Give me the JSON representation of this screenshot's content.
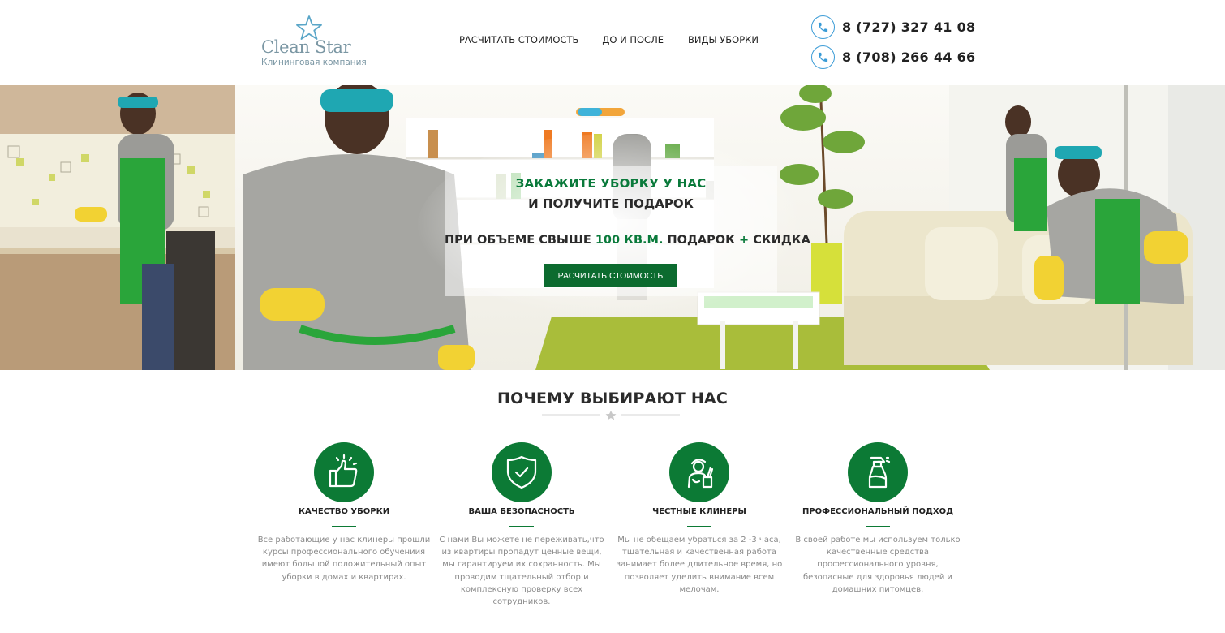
{
  "header": {
    "logo_name": "Clean Star",
    "logo_sub": "Клининговая компания",
    "nav": [
      "Расчитать стоимость",
      "До и после",
      "Виды уборки"
    ],
    "phones": [
      "8 (727) 327 41 08",
      "8 (708) 266 44 66"
    ],
    "colors": {
      "logo": "#7a96a3",
      "phone_icon": "#3a9bd6"
    }
  },
  "hero": {
    "line1": "ЗАКАЖИТЕ УБОРКУ У НАС",
    "line2": "И ПОЛУЧИТЕ ПОДАРОК",
    "line3_a": "ПРИ ОБЪЕМЕ СВЫШЕ ",
    "line3_b": "100 КВ.М.",
    "line3_c": " ПОДАРОК ",
    "line3_d": "+",
    "line3_e": " СКИДКА",
    "button": "РАСЧИТАТЬ СТОИМОСТЬ",
    "colors": {
      "accent": "#0a7a3b",
      "button": "#0c6b2f"
    }
  },
  "why": {
    "title": "ПОЧЕМУ ВЫБИРАЮТ НАС",
    "features": [
      {
        "icon": "thumbs-up-icon",
        "title": "КАЧЕСТВО УБОРКИ",
        "text": "Все работающие у нас клинеры прошли курсы профессионального обучениия имеют большой положительный опыт уборки в домах и квартирах."
      },
      {
        "icon": "shield-check-icon",
        "title": "ВАША БЕЗОПАСНОСТЬ",
        "text": "С нами Вы можете не переживать,что из квартиры пропадут ценные вещи, мы гарантируем их сохранность. Мы проводим тщательный отбор и комплексную проверку всех сотрудников."
      },
      {
        "icon": "cleaner-icon",
        "title": "ЧЕСТНЫЕ КЛИНЕРЫ",
        "text": "Мы не обещаем убраться за 2 -3 часа, тщательная и качественная работа занимает более длительное время, но позволяет уделить внимание всем мелочам."
      },
      {
        "icon": "spray-bottle-icon",
        "title": "ПРОФЕССИОНАЛЬНЫЙ ПОДХОД",
        "text": "В своей работе мы используем только качественные средства профессионального уровня, безопасные для здоровья людей и домашних питомцев."
      }
    ],
    "colors": {
      "icon_bg": "#0c7a35"
    }
  }
}
